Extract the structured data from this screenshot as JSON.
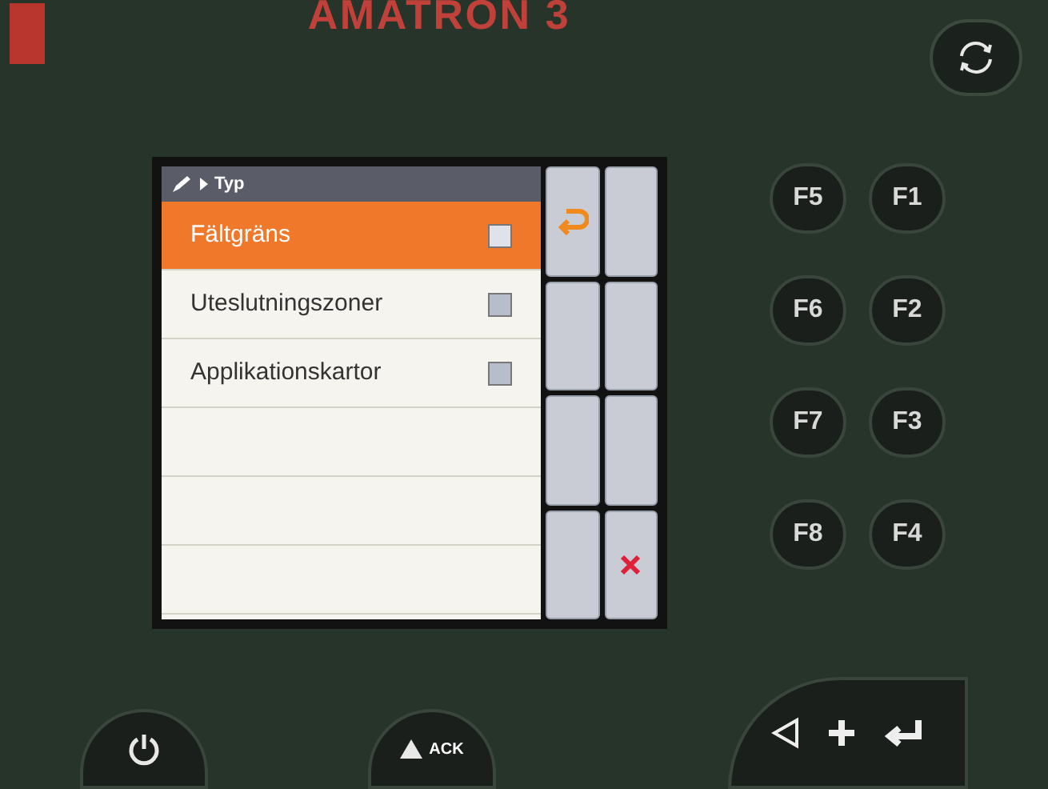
{
  "device": {
    "brand": "AMATRON 3"
  },
  "screen": {
    "breadcrumb": "Typ",
    "rows": [
      {
        "label": "Fältgräns",
        "checked": false,
        "selected": true
      },
      {
        "label": "Uteslutningszoner",
        "checked": false,
        "selected": false
      },
      {
        "label": "Applikationskartor",
        "checked": false,
        "selected": false
      }
    ],
    "softkeys": [
      {
        "kind": "return"
      },
      {
        "kind": "blank"
      },
      {
        "kind": "blank"
      },
      {
        "kind": "blank"
      },
      {
        "kind": "blank"
      },
      {
        "kind": "blank"
      },
      {
        "kind": "blank"
      },
      {
        "kind": "cancel"
      }
    ]
  },
  "function_keys": [
    [
      "F5",
      "F1"
    ],
    [
      "F6",
      "F2"
    ],
    [
      "F7",
      "F3"
    ],
    [
      "F8",
      "F4"
    ]
  ],
  "ack_key": "ACK"
}
